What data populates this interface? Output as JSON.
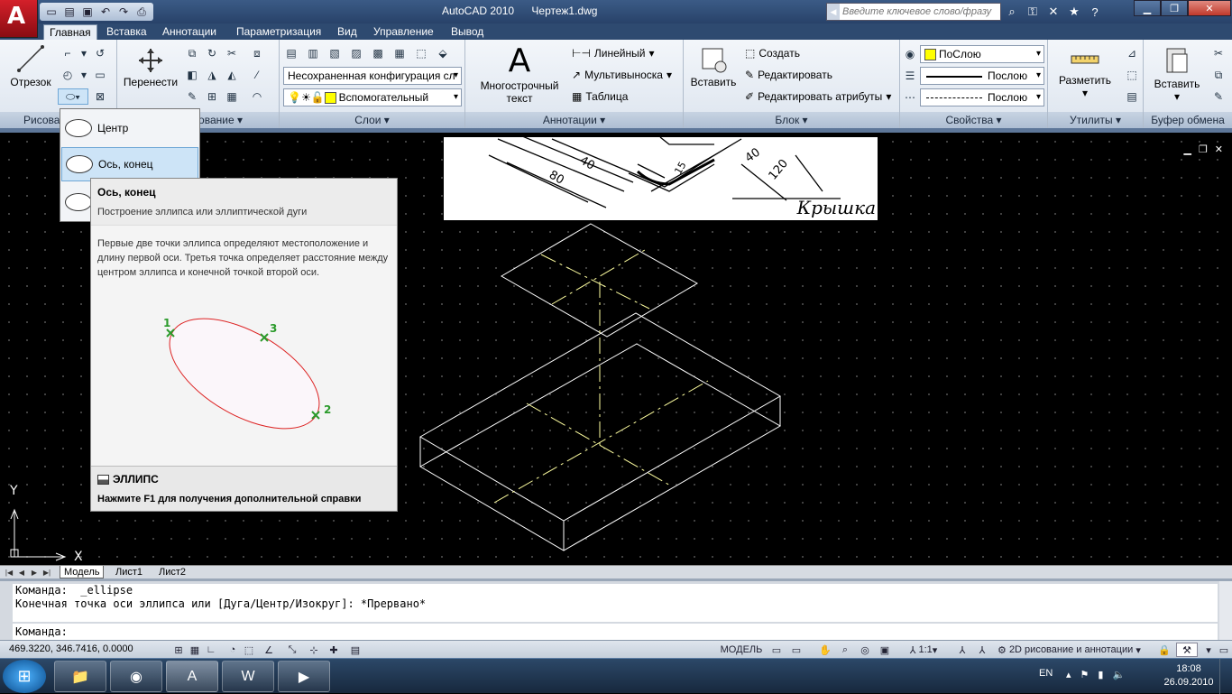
{
  "window": {
    "app_name": "AutoCAD 2010",
    "document": "Чертеж1.dwg"
  },
  "qat": {
    "icons": [
      "new-icon",
      "open-icon",
      "save-icon",
      "undo-icon",
      "redo-icon",
      "plot-icon"
    ]
  },
  "search": {
    "placeholder": "Введите ключевое слово/фразу"
  },
  "tabs": [
    {
      "label": "Главная",
      "active": true
    },
    {
      "label": "Вставка"
    },
    {
      "label": "Аннотации"
    },
    {
      "label": "Параметризация"
    },
    {
      "label": "Вид"
    },
    {
      "label": "Управление"
    },
    {
      "label": "Вывод"
    }
  ],
  "ribbon": {
    "draw": {
      "title": "Рисова",
      "line_label": "Отрезок"
    },
    "modify": {
      "title": "ование",
      "move_label": "Перенести"
    },
    "layers": {
      "title": "Слои",
      "state_combo": "Несохраненная конфигурация сл",
      "layer_combo": "Вспомогательный"
    },
    "annotation": {
      "title": "Аннотации",
      "mtext_label": "Многострочный",
      "mtext_label2": "текст",
      "linear": "Линейный",
      "mleader": "Мультивыноска",
      "table": "Таблица"
    },
    "block": {
      "title": "Блок",
      "insert_label": "Вставить",
      "create": "Создать",
      "edit": "Редактировать",
      "edit_attr": "Редактировать атрибуты"
    },
    "properties": {
      "title": "Свойства",
      "color": "ПоСлою",
      "lineweight": "Послою",
      "linetype": "Послою",
      "accent": "#ffff00"
    },
    "utilities": {
      "title": "Утилиты",
      "measure_label": "Разметить"
    },
    "clipboard": {
      "title": "Буфер обмена",
      "paste_label": "Вставить"
    }
  },
  "dropdown": {
    "items": [
      {
        "label": "Центр"
      },
      {
        "label": "Ось, конец",
        "hot": true
      },
      {
        "label": ""
      }
    ]
  },
  "tooltip": {
    "title": "Ось, конец",
    "subtitle": "Построение эллипса или эллиптической дуги",
    "description": "Первые две точки эллипса определяют местоположение и длину первой оси. Третья точка определяет расстояние между центром эллипса и конечной точкой второй оси.",
    "points": [
      "1",
      "2",
      "3"
    ],
    "command": "ЭЛЛИПС",
    "help": "Нажмите F1 для получения дополнительной справки"
  },
  "ref_image": {
    "label": "Крышка",
    "dims": [
      "80",
      "40",
      "40",
      "120",
      "15"
    ]
  },
  "ucs": {
    "x": "X",
    "y": "Y"
  },
  "layout_tabs": [
    {
      "label": "Модель",
      "active": true
    },
    {
      "label": "Лист1"
    },
    {
      "label": "Лист2"
    }
  ],
  "command_line": {
    "history": [
      "Команда:  _ellipse",
      "Конечная точка оси эллипса или [Дуга/Центр/Изокруг]: *Прервано*"
    ],
    "prompt": "Команда:"
  },
  "status": {
    "coords": "469.3220, 346.7416, 0.0000",
    "model": "МОДЕЛЬ",
    "scale": "1:1",
    "workspace": "2D рисование и аннотации"
  },
  "taskbar": {
    "lang": "EN",
    "time": "18:08",
    "date": "26.09.2010"
  }
}
